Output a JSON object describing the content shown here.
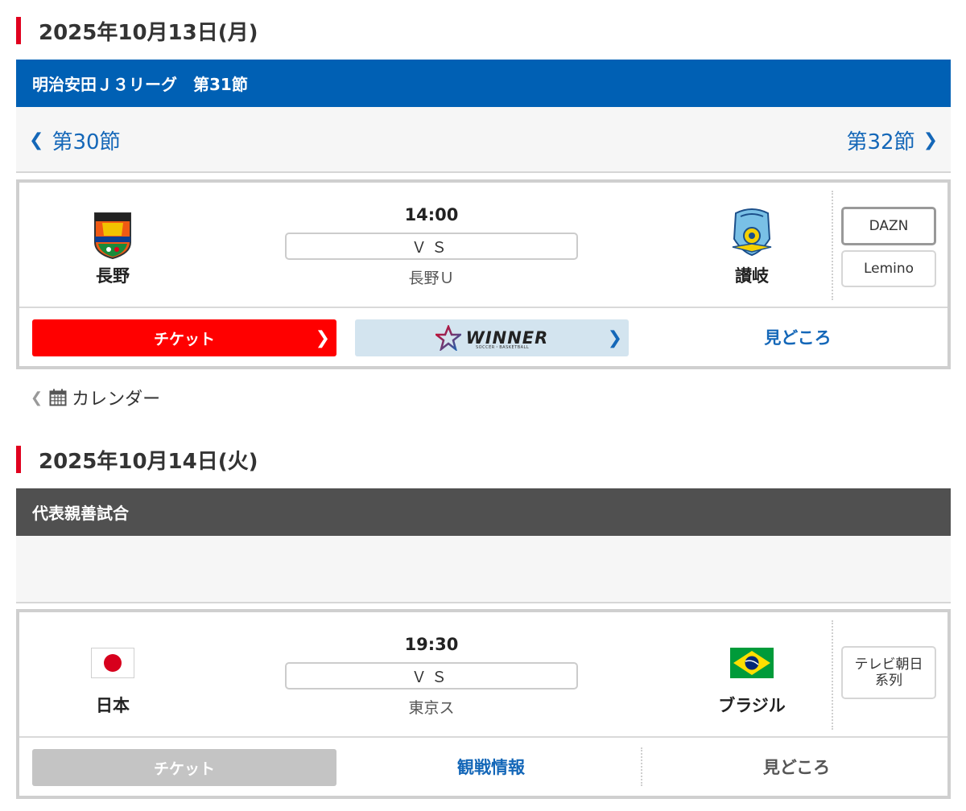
{
  "sections": [
    {
      "date": "2025年10月13日(月)",
      "league": "明治安田Ｊ３リーグ　第31節",
      "league_color": "#0060b4",
      "nav": {
        "prev": "第30節",
        "next": "第32節"
      },
      "match": {
        "time": "14:00",
        "vs": "ＶＳ",
        "venue": "長野Ｕ",
        "home": {
          "name": "長野",
          "logo_text_top": "AC NAGANO",
          "logo_text_mid": "PARCEIRO"
        },
        "away": {
          "name": "讃岐",
          "logo_text": "KAMATAMARE"
        },
        "broadcasts": [
          "DAZN",
          "Lemino"
        ],
        "ticket_label": "チケット",
        "winner_label": "WINNER",
        "winner_sub": "SOCCER・BASKETBALL",
        "highlight_label": "見どころ"
      }
    },
    {
      "date": "2025年10月14日(火)",
      "league": "代表親善試合",
      "league_color": "#505050",
      "match": {
        "time": "19:30",
        "vs": "ＶＳ",
        "venue": "東京ス",
        "home": {
          "name": "日本"
        },
        "away": {
          "name": "ブラジル"
        },
        "broadcasts": [
          "テレビ朝日系列"
        ],
        "ticket_label": "チケット",
        "info_label": "観戦情報",
        "highlight_label": "見どころ"
      }
    }
  ],
  "calendar_label": "カレンダー",
  "colors": {
    "accent_red": "#e0001e",
    "link_blue": "#1467b8",
    "ticket_red": "#ff0000",
    "ticket_disabled": "#c4c4c4"
  }
}
